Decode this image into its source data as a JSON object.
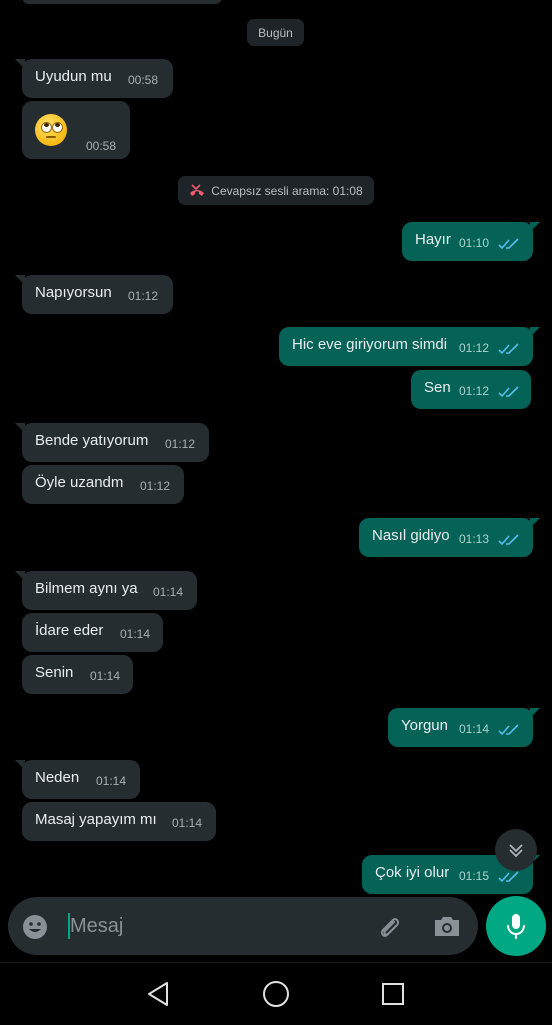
{
  "date_divider": "Bugün",
  "missed_call": "Cevapsız sesli arama: 01:08",
  "composer": {
    "placeholder": "Mesaj"
  },
  "messages": [
    {
      "dir": "in",
      "text": "Uyudun mu",
      "time": "00:58"
    },
    {
      "dir": "in",
      "text": "",
      "emoji": "face-with-rolling-eyes",
      "time": "00:58"
    },
    {
      "dir": "out",
      "text": "Hayır",
      "time": "01:10",
      "status": "read"
    },
    {
      "dir": "in",
      "text": "Napıyorsun",
      "time": "01:12"
    },
    {
      "dir": "out",
      "text": "Hic eve giriyorum simdi",
      "time": "01:12",
      "status": "read"
    },
    {
      "dir": "out",
      "text": "Sen",
      "time": "01:12",
      "status": "read"
    },
    {
      "dir": "in",
      "text": "Bende yatıyorum",
      "time": "01:12"
    },
    {
      "dir": "in",
      "text": "Öyle uzandm",
      "time": "01:12"
    },
    {
      "dir": "out",
      "text": "Nasıl gidiyo",
      "time": "01:13",
      "status": "read"
    },
    {
      "dir": "in",
      "text": "Bilmem aynı ya",
      "time": "01:14"
    },
    {
      "dir": "in",
      "text": "İdare eder",
      "time": "01:14"
    },
    {
      "dir": "in",
      "text": "Senin",
      "time": "01:14"
    },
    {
      "dir": "out",
      "text": "Yorgun",
      "time": "01:14",
      "status": "read"
    },
    {
      "dir": "in",
      "text": "Neden",
      "time": "01:14"
    },
    {
      "dir": "in",
      "text": "Masaj yapayım mı",
      "time": "01:14"
    },
    {
      "dir": "out",
      "text": "Çok iyi olur",
      "time": "01:15",
      "status": "read"
    }
  ],
  "colors": {
    "incoming": "#262d31",
    "outgoing": "#056257",
    "accent": "#00a884",
    "read_ticks": "#53bdeb",
    "missed_call_icon": "#f15c6d"
  },
  "icons": [
    "emoji-icon",
    "attach-icon",
    "camera-icon",
    "mic-icon",
    "scroll-down-icon",
    "nav-back-icon",
    "nav-home-icon",
    "nav-recents-icon",
    "missed-call-icon",
    "read-ticks-icon"
  ]
}
